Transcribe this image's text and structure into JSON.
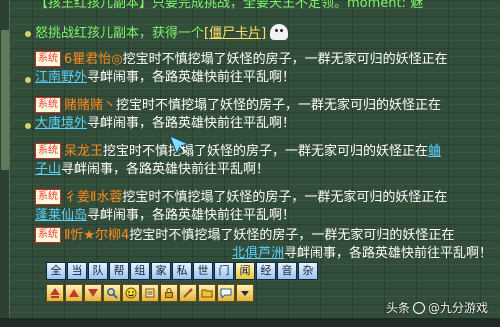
{
  "chat": {
    "line0": {
      "text": "【孩王红孩儿副本】只要完成挑战，全要天王不定领。moment: 魅"
    },
    "line1": {
      "prefix": "怒挑战红孩儿副本，获得一个",
      "item": "[僵尸卡片]"
    },
    "messages": [
      {
        "badge": "系统",
        "player": "6瞿君怡◎",
        "text1": "挖宝时不慎挖塌了妖怪的房子，一群无家可归的妖怪正在",
        "location": "江南野外",
        "text2": "寻衅闹事，各路英雄快前往平乱啊！"
      },
      {
        "badge": "系统",
        "player": "赌赌赌丶",
        "text1": "挖宝时不慎挖塌了妖怪的房子，一群无家可归的妖怪正在",
        "location": "大唐境外",
        "text2": "寻衅闹事，各路英雄快前往平乱啊！"
      },
      {
        "badge": "系统",
        "player": "呆龙王",
        "text1": "挖宝时不慎挖塌了妖怪的房子，一群无家可归的妖怪正在",
        "location_part1": "蛐",
        "location_part2": "子山",
        "text2": "寻衅闹事，各路英雄快前往平乱啊！"
      },
      {
        "badge": "系统",
        "player": "彳姜Ⅱ水蓉",
        "text1": "挖宝时不慎挖塌了妖怪的房子，一群无家可归的妖怪正在",
        "location": "蓬莱仙岛",
        "text2": "寻衅闹事，各路英雄快前往平乱啊！"
      },
      {
        "badge": "系统",
        "player": "Ⅱ忻★尔柳4",
        "text1": "挖宝时不慎挖塌了妖怪的房子，一群无家可归的妖怪",
        "text1b": "正在",
        "location": "北俱芦洲",
        "text2": "寻衅闹事，各路英雄快前往平乱啊！"
      }
    ]
  },
  "channels": [
    "全",
    "当",
    "队",
    "帮",
    "组",
    "家",
    "私",
    "世",
    "门",
    "闻",
    "经",
    "音",
    "杂"
  ],
  "active_channel": "闻",
  "tools": [
    "up-arrow-icon",
    "up-arrow-icon",
    "down-arrow-icon",
    "magnifier-icon",
    "smiley-icon",
    "scroll-icon",
    "lock-icon",
    "brush-icon",
    "folder-icon",
    "speech-bubble-icon",
    "dropdown-arrow-icon"
  ],
  "watermark": {
    "brand": "头条",
    "handle": "@九分游戏"
  },
  "colors": {
    "background": "#324e3a",
    "system_badge": "#ff3b3b",
    "player": "#ff8a1e",
    "location": "#5ad0ff",
    "message": "#ffffff",
    "item": "#7df56b"
  }
}
